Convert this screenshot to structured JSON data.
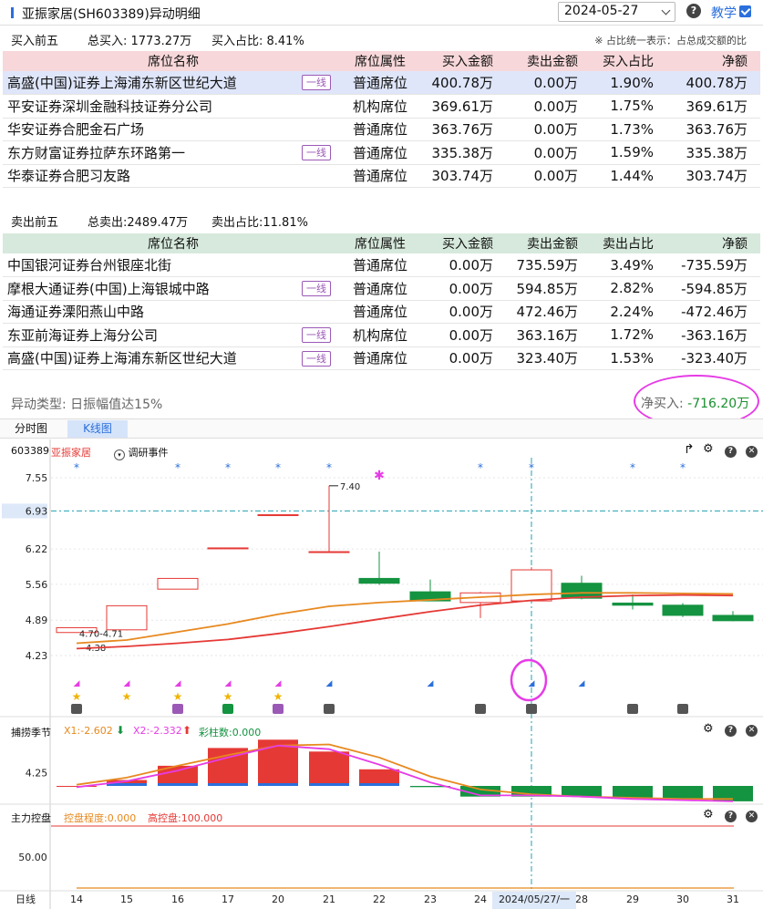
{
  "header": {
    "title": "亚振家居(SH603389)异动明细",
    "date": "2024-05-27",
    "help": "?",
    "teach": "教学"
  },
  "buy_summary": {
    "label": "买入前五",
    "total": "总买入: 1773.27万",
    "ratio": "买入占比: 8.41%",
    "note": "※ 占比统一表示：占总成交额的比"
  },
  "sell_summary": {
    "label": "卖出前五",
    "total": "总卖出:2489.47万",
    "ratio": "卖出占比:11.81%"
  },
  "buy_headers": [
    "席位名称",
    "席位属性",
    "买入金额",
    "卖出金额",
    "买入占比",
    "净额"
  ],
  "sell_headers": [
    "席位名称",
    "席位属性",
    "买入金额",
    "卖出金额",
    "卖出占比",
    "净额"
  ],
  "buy_rows": [
    {
      "name": "高盛(中国)证券上海浦东新区世纪大道",
      "tag": "一线",
      "attr": "普通席位",
      "buy": "400.78万",
      "sell": "0.00万",
      "ratio": "1.90%",
      "net": "400.78万"
    },
    {
      "name": "平安证券深圳金融科技证券分公司",
      "tag": "",
      "attr": "机构席位",
      "buy": "369.61万",
      "sell": "0.00万",
      "ratio": "1.75%",
      "net": "369.61万"
    },
    {
      "name": "华安证券合肥金石广场",
      "tag": "",
      "attr": "普通席位",
      "buy": "363.76万",
      "sell": "0.00万",
      "ratio": "1.73%",
      "net": "363.76万"
    },
    {
      "name": "东方财富证券拉萨东环路第一",
      "tag": "一线",
      "attr": "普通席位",
      "buy": "335.38万",
      "sell": "0.00万",
      "ratio": "1.59%",
      "net": "335.38万"
    },
    {
      "name": "华泰证券合肥习友路",
      "tag": "",
      "attr": "普通席位",
      "buy": "303.74万",
      "sell": "0.00万",
      "ratio": "1.44%",
      "net": "303.74万"
    }
  ],
  "sell_rows": [
    {
      "name": "中国银河证券台州银座北街",
      "tag": "",
      "attr": "普通席位",
      "buy": "0.00万",
      "sell": "735.59万",
      "ratio": "3.49%",
      "net": "-735.59万"
    },
    {
      "name": "摩根大通证券(中国)上海银城中路",
      "tag": "一线",
      "attr": "普通席位",
      "buy": "0.00万",
      "sell": "594.85万",
      "ratio": "2.82%",
      "net": "-594.85万"
    },
    {
      "name": "海通证券溧阳燕山中路",
      "tag": "",
      "attr": "普通席位",
      "buy": "0.00万",
      "sell": "472.46万",
      "ratio": "2.24%",
      "net": "-472.46万"
    },
    {
      "name": "东亚前海证券上海分公司",
      "tag": "一线",
      "attr": "机构席位",
      "buy": "0.00万",
      "sell": "363.16万",
      "ratio": "1.72%",
      "net": "-363.16万"
    },
    {
      "name": "高盛(中国)证券上海浦东新区世纪大道",
      "tag": "一线",
      "attr": "普通席位",
      "buy": "0.00万",
      "sell": "323.40万",
      "ratio": "1.53%",
      "net": "-323.40万"
    }
  ],
  "abnormal": {
    "type": "异动类型: 日振幅值达15%",
    "net_label": "净买入: ",
    "net_value": "-716.20万"
  },
  "tabs": [
    "分时图",
    "K线图"
  ],
  "chart_head": {
    "code": "603389",
    "name": "亚振家居",
    "event": "调研事件"
  },
  "sub1": {
    "name": "捕捞季节",
    "x1": "X1:-2.602",
    "x2": "X2:-2.332",
    "col": "彩柱数:0.000"
  },
  "sub2": {
    "name": "主力控盘",
    "a": "控盘程度:0.000",
    "b": "高控盘:100.000"
  },
  "axis": {
    "ticks": [
      "7.55",
      "6.93",
      "6.22",
      "5.56",
      "4.89",
      "4.23"
    ],
    "sub1_tick": "4.25",
    "sub2_tick": "50.00",
    "period": "日线",
    "cursor_date": "2024/05/27/一",
    "x_labels": [
      "14",
      "15",
      "16",
      "17",
      "20",
      "21",
      "22",
      "23",
      "24",
      "28",
      "29",
      "30",
      "31"
    ]
  },
  "chart_data": {
    "type": "candlestick",
    "dates": [
      "14",
      "15",
      "16",
      "17",
      "20",
      "21",
      "22",
      "23",
      "24",
      "27",
      "28",
      "29",
      "30",
      "31"
    ],
    "ohlc": [
      [
        4.66,
        4.75,
        4.66,
        4.75
      ],
      [
        4.71,
        5.16,
        4.7,
        5.16
      ],
      [
        5.47,
        5.67,
        5.47,
        5.67
      ],
      [
        6.24,
        6.24,
        6.24,
        6.24
      ],
      [
        6.86,
        6.86,
        6.86,
        6.86
      ],
      [
        6.17,
        7.4,
        6.17,
        6.17
      ],
      [
        5.67,
        6.17,
        5.55,
        5.58
      ],
      [
        5.42,
        5.65,
        5.26,
        5.25
      ],
      [
        5.22,
        5.42,
        4.93,
        5.4
      ],
      [
        5.25,
        5.88,
        5.25,
        5.83
      ],
      [
        5.58,
        5.72,
        5.28,
        5.3
      ],
      [
        5.21,
        5.37,
        5.09,
        5.17
      ],
      [
        5.17,
        5.21,
        4.95,
        4.98
      ],
      [
        4.98,
        5.06,
        4.87,
        4.88
      ]
    ],
    "annotations": [
      "7.40",
      "4.70-4.71",
      "4.38"
    ],
    "ma_orange": [
      4.46,
      4.52,
      4.67,
      4.82,
      5.0,
      5.15,
      5.22,
      5.27,
      5.32,
      5.37,
      5.4,
      5.4,
      5.39,
      5.38
    ],
    "ma_red": [
      4.36,
      4.4,
      4.46,
      4.53,
      4.64,
      4.77,
      4.91,
      5.05,
      5.17,
      5.26,
      5.32,
      5.35,
      5.36,
      5.35
    ],
    "sub1_bars": [
      0.0,
      0.25,
      0.85,
      1.6,
      1.95,
      1.45,
      0.7,
      -0.05,
      -0.45,
      -0.45,
      -0.45,
      -0.5,
      -0.55,
      -0.65
    ],
    "sub1_x1": [
      0.05,
      0.35,
      0.85,
      1.3,
      1.7,
      1.75,
      1.2,
      0.4,
      -0.15,
      -0.35,
      -0.45,
      -0.5,
      -0.55,
      -0.55
    ],
    "sub1_x2": [
      -0.05,
      0.2,
      0.65,
      1.2,
      1.7,
      1.55,
      0.9,
      0.15,
      -0.4,
      -0.4,
      -0.45,
      -0.55,
      -0.6,
      -0.65
    ],
    "colors": {
      "up": "#e53935",
      "down": "#149340",
      "ma1": "#e7891f",
      "ma2": "#e53935",
      "pink": "#e63ce6"
    }
  }
}
